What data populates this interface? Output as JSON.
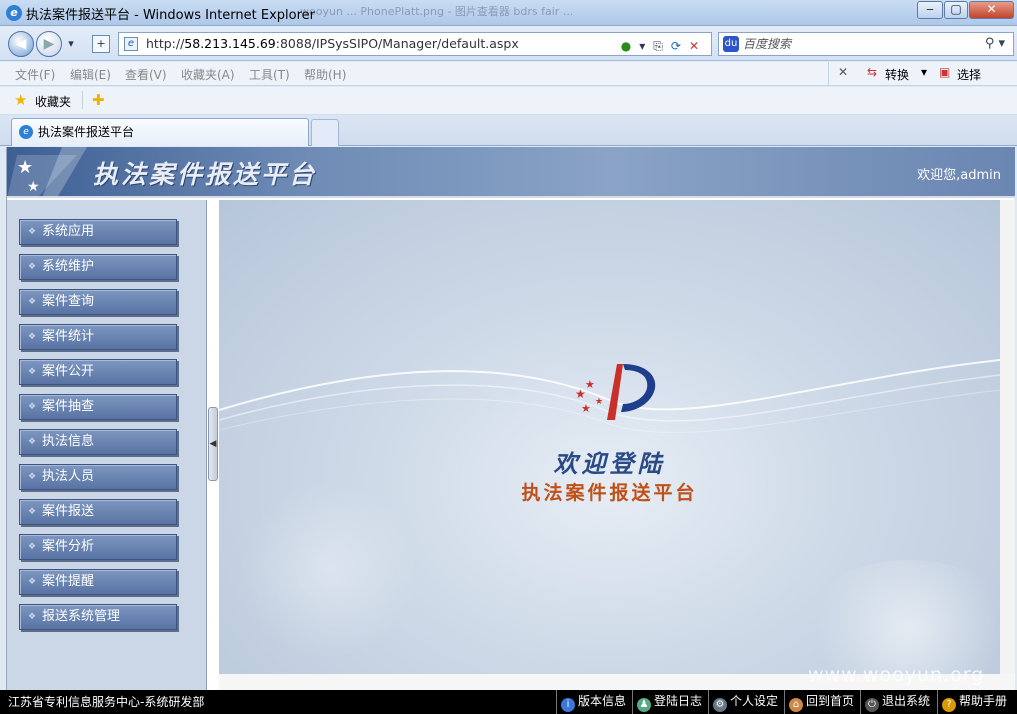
{
  "window": {
    "title": "执法案件报送平台 - Windows Internet Explorer",
    "ghost_tabs": "wooyun ...      PhonePlatt.png - 图片查看器      bdrs fair ..."
  },
  "address": {
    "url_prefix": "http://",
    "url_host": "58.213.145.69",
    "url_rest": ":8088/IPSysSIPO/Manager/default.aspx",
    "search_placeholder": "百度搜索"
  },
  "menu": {
    "items": [
      "文件(F)",
      "编辑(E)",
      "查看(V)",
      "收藏夹(A)",
      "工具(T)",
      "帮助(H)"
    ],
    "translate": "转换",
    "select": "选择"
  },
  "favorites": {
    "label": "收藏夹"
  },
  "tab": {
    "title": "执法案件报送平台"
  },
  "banner": {
    "title": "执法案件报送平台",
    "welcome": "欢迎您,admin"
  },
  "sidebar": {
    "items": [
      "系统应用",
      "系统维护",
      "案件查询",
      "案件统计",
      "案件公开",
      "案件抽查",
      "执法信息",
      "执法人员",
      "案件报送",
      "案件分析",
      "案件提醒",
      "报送系统管理"
    ]
  },
  "main": {
    "welcome_title": "欢迎登陆",
    "welcome_subtitle": "执法案件报送平台"
  },
  "status": {
    "left": "江苏省专利信息服务中心-系统研发部",
    "items": [
      "版本信息",
      "登陆日志",
      "个人设定",
      "回到首页",
      "退出系统",
      "帮助手册"
    ]
  },
  "watermark": "www.wooyun.org",
  "colors": {
    "banner": "#5a78a8",
    "sidebar_button": "#6a84b2",
    "status_bg": "#000000",
    "accent_red": "#c8302a"
  }
}
